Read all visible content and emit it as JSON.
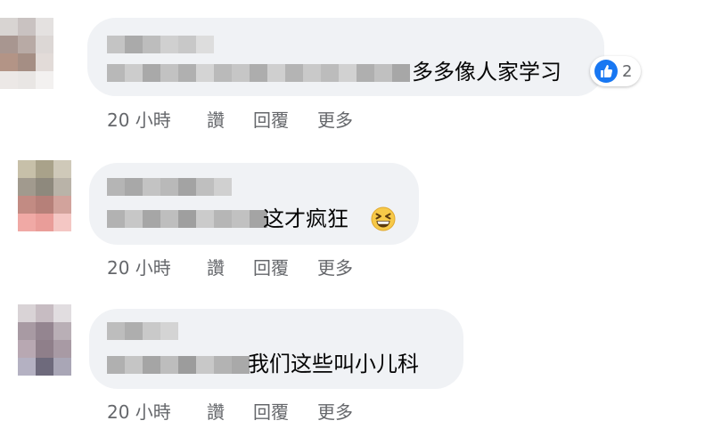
{
  "comments": [
    {
      "text": "多多像人家学习",
      "timestamp": "20 小時",
      "actions": {
        "like": "讚",
        "reply": "回覆",
        "more": "更多"
      },
      "reaction": {
        "icon": "thumbs-up-icon",
        "count": "2"
      }
    },
    {
      "text": "这才疯狂",
      "timestamp": "20 小時",
      "actions": {
        "like": "讚",
        "reply": "回覆",
        "more": "更多"
      },
      "emoji": "grinning-squinting-face-icon"
    },
    {
      "text": "我们这些叫小儿科",
      "timestamp": "20 小時",
      "actions": {
        "like": "讚",
        "reply": "回覆",
        "more": "更多"
      }
    }
  ],
  "colors": {
    "bubble": "#f0f2f5",
    "text": "#050505",
    "secondary_text": "#65676b",
    "like_blue": "#1877f2"
  }
}
